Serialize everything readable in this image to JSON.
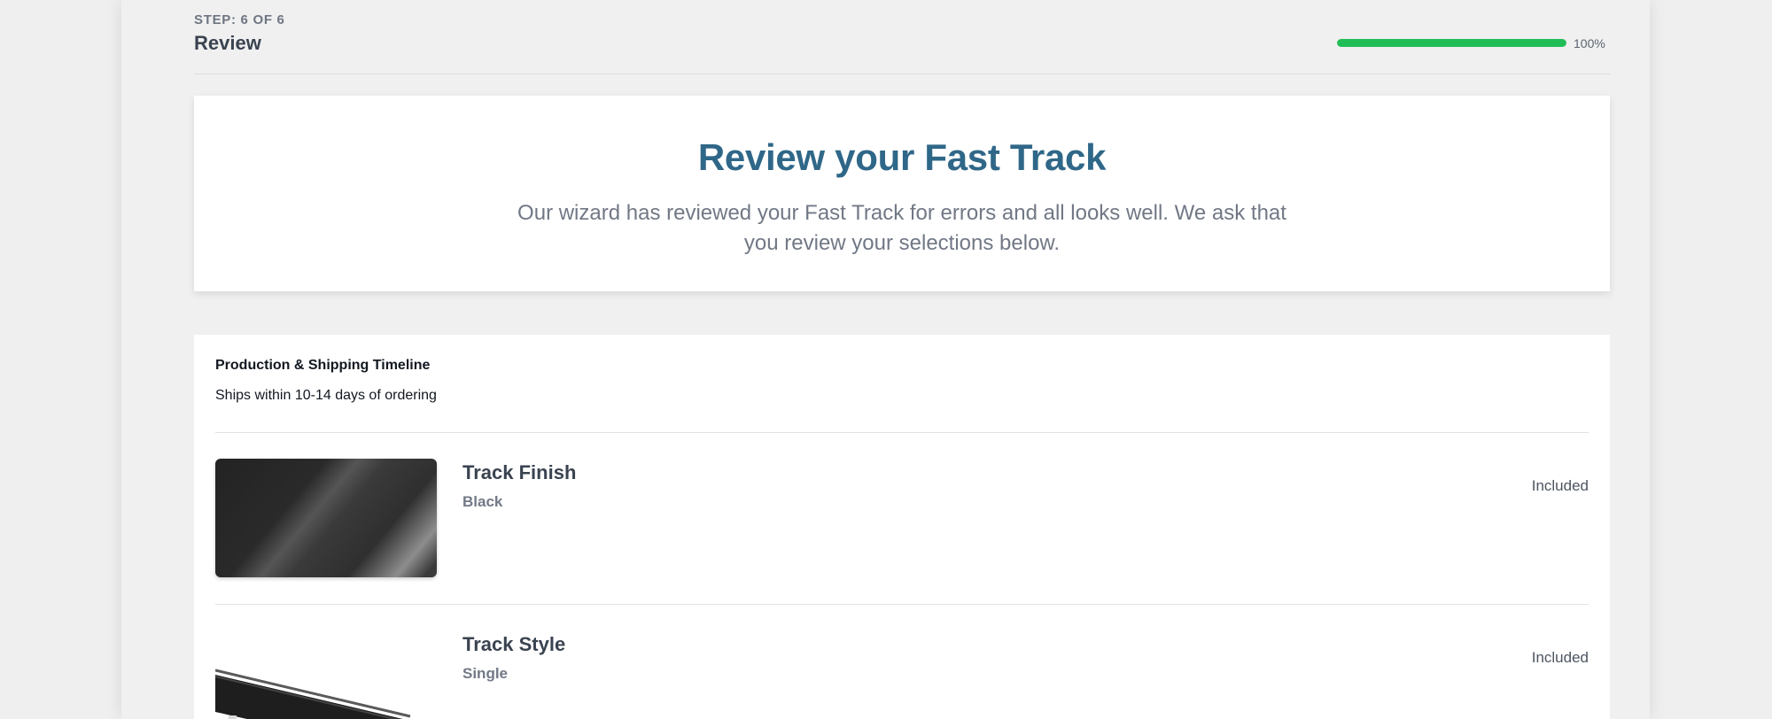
{
  "header": {
    "step_label": "STEP: 6 OF 6",
    "title": "Review",
    "progress": {
      "value_percent": 100,
      "label": "100%",
      "accent_color": "#21bd57"
    }
  },
  "hero": {
    "title": "Review your Fast Track",
    "text": "Our wizard has reviewed your Fast Track for errors and all looks well. We ask that you review your selections below."
  },
  "review": {
    "timeline": {
      "title": "Production & Shipping Timeline",
      "text": "Ships within 10-14 days of ordering"
    },
    "items": [
      {
        "name": "Track Finish",
        "value": "Black",
        "price": "Included",
        "image": "black-finish-swatch"
      },
      {
        "name": "Track Style",
        "value": "Single",
        "price": "Included",
        "image": "single-track-product-image"
      }
    ]
  }
}
